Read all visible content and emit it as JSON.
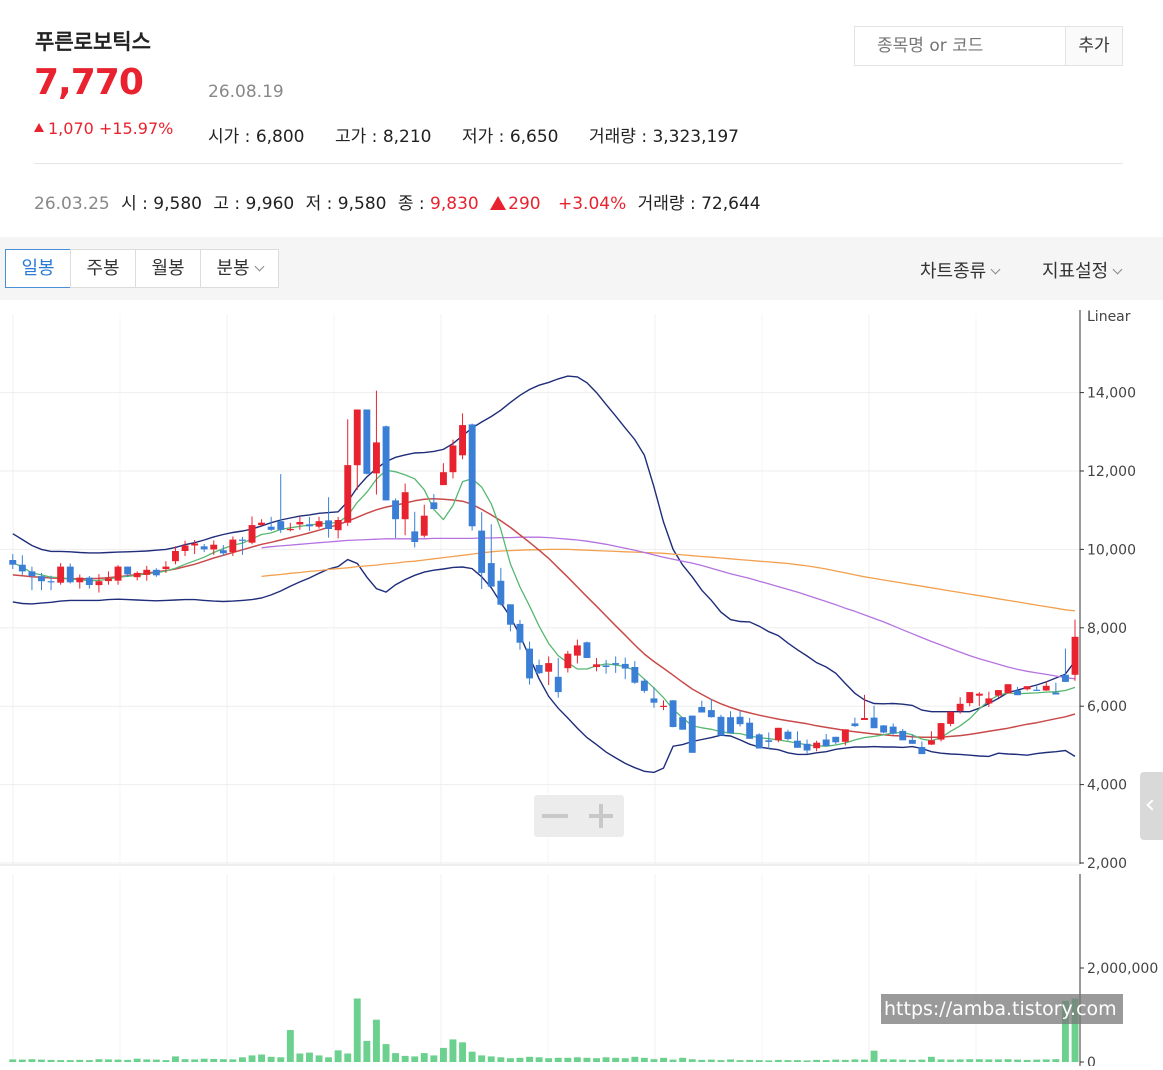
{
  "header": {
    "stock_name": "푸른로보틱스",
    "price": "7,770",
    "date": "26.08.19",
    "change": "1,070",
    "change_pct": "+15.97%",
    "open_label": "시가 : 6,800",
    "high_label": "고가 : 8,210",
    "low_label": "저가 : 6,650",
    "volume_label": "거래량 : 3,323,197"
  },
  "search": {
    "placeholder": "종목명 or 코드",
    "add_label": "추가"
  },
  "hover": {
    "date": "26.03.25",
    "open": "시 : 9,580",
    "high": "고 : 9,960",
    "low": "저 : 9,580",
    "close_label": "종 : ",
    "close_value": "9,830",
    "change": "290",
    "change_pct": "+3.04%",
    "volume": "거래량 : 72,644"
  },
  "toolbar": {
    "tabs": [
      "일봉",
      "주봉",
      "월봉",
      "분봉"
    ],
    "chart_type": "차트종류",
    "indicator": "지표설정"
  },
  "colors": {
    "up": "#e8232f",
    "down": "#3a7fd5",
    "ma5": "#56b870",
    "ma20": "#c94a4a",
    "ma60": "#b573e0",
    "ma120": "#f2a04f",
    "bollinger": "#1f2d7a",
    "volume": "#6cd18e"
  },
  "watermark": "https://amba.tistory.com",
  "chart_data": {
    "type": "candlestick",
    "scale": "Linear",
    "ylim": [
      2000,
      15000
    ],
    "price_ticks": [
      "2,000",
      "4,000",
      "6,000",
      "8,000",
      "10,000",
      "12,000",
      "14,000"
    ],
    "volume_ticks": [
      "0",
      "2,000,000"
    ],
    "volume_max": 3800000,
    "candles": [
      [
        9730,
        9880,
        9500,
        9610
      ],
      [
        9610,
        9850,
        9350,
        9440
      ],
      [
        9440,
        9560,
        8960,
        9320
      ],
      [
        9320,
        9400,
        8960,
        9190
      ],
      [
        9190,
        9330,
        8960,
        9170
      ],
      [
        9150,
        9650,
        9100,
        9560
      ],
      [
        9560,
        9640,
        9130,
        9160
      ],
      [
        9160,
        9360,
        9000,
        9280
      ],
      [
        9280,
        9320,
        9000,
        9090
      ],
      [
        9090,
        9370,
        8900,
        9190
      ],
      [
        9190,
        9440,
        9100,
        9260
      ],
      [
        9200,
        9600,
        9100,
        9560
      ],
      [
        9560,
        9560,
        9300,
        9360
      ],
      [
        9290,
        9440,
        9210,
        9400
      ],
      [
        9350,
        9580,
        9200,
        9480
      ],
      [
        9480,
        9520,
        9300,
        9340
      ],
      [
        9500,
        9700,
        9400,
        9560
      ],
      [
        9700,
        10080,
        9620,
        9960
      ],
      [
        9960,
        10220,
        9830,
        10100
      ],
      [
        10100,
        10240,
        9880,
        10150
      ],
      [
        10080,
        10140,
        9930,
        10000
      ],
      [
        10000,
        10230,
        9860,
        10120
      ],
      [
        9980,
        10110,
        9830,
        9900
      ],
      [
        9930,
        10330,
        9830,
        10250
      ],
      [
        10250,
        10320,
        9860,
        10230
      ],
      [
        10170,
        10840,
        10130,
        10620
      ],
      [
        10620,
        10770,
        10600,
        10680
      ],
      [
        10580,
        10830,
        10470,
        10500
      ],
      [
        10720,
        11920,
        10420,
        10500
      ],
      [
        10500,
        10680,
        10460,
        10520
      ],
      [
        10640,
        10830,
        10500,
        10700
      ],
      [
        10640,
        10830,
        10470,
        10590
      ],
      [
        10580,
        10830,
        10530,
        10720
      ],
      [
        10740,
        11330,
        10300,
        10520
      ],
      [
        10490,
        10830,
        10280,
        10750
      ],
      [
        10680,
        13320,
        10600,
        12150
      ],
      [
        12150,
        13570,
        11520,
        13570
      ],
      [
        13570,
        13340,
        11910,
        11930
      ],
      [
        11940,
        14050,
        11400,
        12730
      ],
      [
        13140,
        13160,
        11680,
        11250
      ],
      [
        11250,
        11300,
        10290,
        10770
      ],
      [
        10770,
        11680,
        10360,
        11460
      ],
      [
        10460,
        10960,
        10050,
        10190
      ],
      [
        10350,
        11140,
        10300,
        10860
      ],
      [
        11200,
        11410,
        11130,
        11030
      ],
      [
        11640,
        12200,
        11780,
        11970
      ],
      [
        11970,
        12800,
        11810,
        12650
      ],
      [
        12400,
        13470,
        12300,
        13170
      ],
      [
        13190,
        13210,
        10480,
        10590
      ],
      [
        10480,
        10950,
        8990,
        9400
      ],
      [
        9650,
        10640,
        9390,
        9050
      ],
      [
        9200,
        9530,
        8570,
        8590
      ],
      [
        8600,
        8450,
        7910,
        8080
      ],
      [
        8100,
        8200,
        7440,
        7620
      ],
      [
        7470,
        7650,
        6550,
        6710
      ],
      [
        7050,
        7190,
        6820,
        6840
      ],
      [
        6880,
        7270,
        6540,
        7100
      ],
      [
        6750,
        7230,
        6220,
        6360
      ],
      [
        6970,
        7410,
        6860,
        7340
      ],
      [
        7290,
        7700,
        7090,
        7550
      ],
      [
        7630,
        7650,
        7350,
        7230
      ],
      [
        7000,
        7230,
        6890,
        7070
      ],
      [
        7040,
        7180,
        6830,
        7000
      ],
      [
        7100,
        7270,
        6850,
        7060
      ],
      [
        7080,
        7240,
        6690,
        6960
      ],
      [
        7000,
        7150,
        6570,
        6600
      ],
      [
        6650,
        6700,
        6340,
        6390
      ],
      [
        6200,
        6480,
        5960,
        6090
      ],
      [
        5990,
        6150,
        5900,
        6010
      ],
      [
        6150,
        5960,
        5460,
        5470
      ],
      [
        5720,
        5430,
        5480,
        5400
      ],
      [
        5760,
        5510,
        4980,
        4810
      ],
      [
        5980,
        6140,
        5850,
        5840
      ],
      [
        5900,
        6180,
        5710,
        5720
      ],
      [
        5730,
        5780,
        5510,
        5250
      ],
      [
        5720,
        5870,
        5480,
        5310
      ],
      [
        5730,
        5900,
        5480,
        5540
      ],
      [
        5580,
        5700,
        5330,
        5170
      ],
      [
        5280,
        5310,
        5030,
        4920
      ],
      [
        5130,
        5330,
        4900,
        5090
      ],
      [
        5130,
        5310,
        5080,
        5450
      ],
      [
        5350,
        5400,
        5120,
        5160
      ],
      [
        5120,
        5360,
        4950,
        4940
      ],
      [
        5040,
        5150,
        4780,
        4870
      ],
      [
        4930,
        5120,
        4850,
        5070
      ],
      [
        5150,
        5290,
        4980,
        4980
      ],
      [
        5220,
        5200,
        5030,
        5080
      ],
      [
        5090,
        5290,
        5000,
        5410
      ],
      [
        5560,
        5710,
        5470,
        5490
      ],
      [
        5650,
        6290,
        5650,
        5700
      ],
      [
        5710,
        6010,
        5470,
        5440
      ],
      [
        5510,
        5520,
        5310,
        5330
      ],
      [
        5480,
        5560,
        5270,
        5300
      ],
      [
        5370,
        5420,
        5150,
        5130
      ],
      [
        5140,
        5280,
        5100,
        5040
      ],
      [
        4960,
        5100,
        4890,
        4780
      ],
      [
        5020,
        5360,
        5010,
        5130
      ],
      [
        5150,
        5390,
        5100,
        5570
      ],
      [
        5550,
        5830,
        5490,
        5860
      ],
      [
        5880,
        6230,
        5810,
        6060
      ],
      [
        6080,
        6360,
        6000,
        6360
      ],
      [
        6270,
        6360,
        6000,
        6320
      ],
      [
        6070,
        6370,
        5980,
        6200
      ],
      [
        6270,
        6390,
        6220,
        6410
      ],
      [
        6330,
        6500,
        6320,
        6560
      ],
      [
        6400,
        6490,
        6330,
        6280
      ],
      [
        6430,
        6500,
        6400,
        6510
      ],
      [
        6420,
        6510,
        6400,
        6390
      ],
      [
        6400,
        6640,
        6390,
        6520
      ],
      [
        6350,
        6600,
        6390,
        6300
      ],
      [
        6800,
        7470,
        6710,
        6620
      ],
      [
        6800,
        8210,
        6650,
        7770
      ]
    ],
    "ma5": [
      9660,
      9550,
      9400,
      9350,
      9290,
      9280,
      9240,
      9230,
      9200,
      9210,
      9240,
      9290,
      9310,
      9340,
      9380,
      9400,
      9450,
      9520,
      9620,
      9710,
      9800,
      9920,
      10020,
      10110,
      10160,
      10270,
      10380,
      10420,
      10510,
      10550,
      10590,
      10620,
      10650,
      10670,
      10680,
      10860,
      11200,
      11460,
      11790,
      12020,
      11980,
      11900,
      11800,
      11520,
      11020,
      10760,
      11120,
      11730,
      11800,
      11590,
      11160,
      10510,
      9630,
      9040,
      8560,
      8040,
      7600,
      7290,
      7110,
      6950,
      6950,
      7030,
      7080,
      7050,
      7010,
      6910,
      6690,
      6470,
      6220,
      5920,
      5700,
      5500,
      5450,
      5410,
      5350,
      5310,
      5300,
      5240,
      5200,
      5170,
      5140,
      5100,
      5060,
      5010,
      4990,
      4980,
      5010,
      5060,
      5140,
      5200,
      5230,
      5270,
      5320,
      5330,
      5270,
      5160,
      5120,
      5200,
      5360,
      5500,
      5680,
      5930,
      6140,
      6280,
      6340,
      6320,
      6330,
      6340,
      6360,
      6370,
      6400,
      6480
    ],
    "ma20": [
      9350,
      9330,
      9300,
      9290,
      9270,
      9260,
      9250,
      9250,
      9250,
      9260,
      9280,
      9300,
      9330,
      9360,
      9390,
      9430,
      9460,
      9500,
      9560,
      9620,
      9700,
      9780,
      9850,
      9920,
      9990,
      10060,
      10130,
      10180,
      10240,
      10300,
      10360,
      10420,
      10490,
      10560,
      10630,
      10720,
      10820,
      10920,
      11010,
      11080,
      11130,
      11180,
      11240,
      11280,
      11290,
      11280,
      11260,
      11230,
      11150,
      11020,
      10880,
      10730,
      10560,
      10370,
      10180,
      9980,
      9770,
      9530,
      9290,
      9040,
      8790,
      8550,
      8300,
      8050,
      7810,
      7560,
      7330,
      7140,
      6970,
      6790,
      6610,
      6440,
      6300,
      6170,
      6060,
      5970,
      5890,
      5830,
      5770,
      5720,
      5670,
      5630,
      5590,
      5550,
      5500,
      5460,
      5420,
      5380,
      5350,
      5320,
      5290,
      5270,
      5250,
      5240,
      5220,
      5210,
      5210,
      5210,
      5230,
      5250,
      5280,
      5320,
      5360,
      5400,
      5440,
      5490,
      5540,
      5580,
      5630,
      5680,
      5730,
      5800
    ],
    "ma60": [
      10040,
      10070,
      10090,
      10110,
      10130,
      10150,
      10170,
      10190,
      10210,
      10230,
      10240,
      10250,
      10260,
      10270,
      10270,
      10270,
      10270,
      10270,
      10280,
      10280,
      10280,
      10280,
      10280,
      10290,
      10290,
      10300,
      10300,
      10310,
      10310,
      10310,
      10300,
      10280,
      10260,
      10240,
      10210,
      10170,
      10130,
      10080,
      10030,
      9980,
      9920,
      9860,
      9800,
      9750,
      9700,
      9650,
      9590,
      9520,
      9450,
      9380,
      9320,
      9260,
      9190,
      9120,
      9050,
      8980,
      8910,
      8830,
      8750,
      8670,
      8590,
      8500,
      8420,
      8330,
      8240,
      8150,
      8050,
      7950,
      7850,
      7750,
      7650,
      7560,
      7470,
      7380,
      7290,
      7210,
      7140,
      7070,
      7000,
      6940,
      6890,
      6850,
      6810,
      6770,
      6730,
      6700
    ],
    "ma120": [
      9310,
      9340,
      9360,
      9390,
      9410,
      9440,
      9460,
      9490,
      9510,
      9530,
      9560,
      9580,
      9600,
      9630,
      9650,
      9680,
      9700,
      9730,
      9760,
      9790,
      9820,
      9850,
      9880,
      9910,
      9940,
      9960,
      9970,
      9980,
      9990,
      9990,
      10000,
      10000,
      10000,
      9990,
      9980,
      9970,
      9960,
      9950,
      9940,
      9930,
      9920,
      9910,
      9900,
      9880,
      9860,
      9840,
      9820,
      9800,
      9780,
      9760,
      9740,
      9720,
      9700,
      9680,
      9660,
      9640,
      9610,
      9580,
      9540,
      9500,
      9450,
      9400,
      9350,
      9300,
      9260,
      9220,
      9180,
      9140,
      9100,
      9060,
      9020,
      8980,
      8940,
      8900,
      8860,
      8820,
      8780,
      8740,
      8700,
      8660,
      8620,
      8580,
      8540,
      8500,
      8460,
      8430
    ],
    "bb_upper": [
      10400,
      10250,
      10100,
      10000,
      9950,
      9950,
      9940,
      9920,
      9910,
      9910,
      9920,
      9930,
      9940,
      9950,
      9960,
      9980,
      10000,
      10050,
      10120,
      10170,
      10240,
      10320,
      10380,
      10430,
      10470,
      10520,
      10600,
      10680,
      10750,
      10800,
      10850,
      10880,
      10920,
      10940,
      10960,
      11220,
      11580,
      11850,
      12060,
      12240,
      12350,
      12410,
      12460,
      12470,
      12500,
      12550,
      12700,
      12900,
      13100,
      13250,
      13390,
      13550,
      13750,
      13930,
      14080,
      14190,
      14260,
      14350,
      14420,
      14400,
      14250,
      14000,
      13700,
      13400,
      13100,
      12800,
      12400,
      11600,
      10700,
      10000,
      9600,
      9300,
      8960,
      8700,
      8400,
      8210,
      8160,
      8150,
      8040,
      7900,
      7800,
      7610,
      7440,
      7280,
      7110,
      7000,
      6840,
      6580,
      6330,
      6160,
      6070,
      6060,
      6070,
      6050,
      6020,
      5900,
      5860,
      5860,
      5860,
      5860,
      5860,
      5950,
      6070,
      6200,
      6350,
      6410,
      6480,
      6540,
      6620,
      6720,
      6820,
      7150
    ],
    "bb_lower": [
      8660,
      8620,
      8610,
      8630,
      8650,
      8680,
      8700,
      8700,
      8700,
      8700,
      8720,
      8730,
      8720,
      8710,
      8700,
      8690,
      8700,
      8710,
      8720,
      8720,
      8700,
      8680,
      8670,
      8680,
      8700,
      8720,
      8760,
      8840,
      8940,
      9060,
      9170,
      9270,
      9390,
      9500,
      9560,
      9740,
      9640,
      9290,
      9000,
      8910,
      9100,
      9230,
      9340,
      9420,
      9470,
      9500,
      9540,
      9550,
      9510,
      9300,
      9020,
      8640,
      8280,
      7800,
      7260,
      6700,
      6250,
      5950,
      5700,
      5440,
      5200,
      5020,
      4830,
      4680,
      4540,
      4430,
      4340,
      4310,
      4420,
      4980,
      5020,
      5100,
      5150,
      5200,
      5260,
      5240,
      5140,
      5030,
      4960,
      4920,
      4890,
      4810,
      4770,
      4770,
      4810,
      4840,
      4900,
      4930,
      4960,
      4960,
      4970,
      4960,
      4960,
      4950,
      4970,
      4920,
      4840,
      4800,
      4780,
      4770,
      4750,
      4730,
      4720,
      4800,
      4780,
      4770,
      4750,
      4790,
      4820,
      4840,
      4870,
      4720
    ],
    "volumes": [
      55,
      50,
      60,
      50,
      45,
      40,
      40,
      45,
      40,
      60,
      55,
      50,
      45,
      70,
      55,
      50,
      40,
      120,
      60,
      55,
      70,
      65,
      60,
      55,
      100,
      140,
      160,
      110,
      100,
      680,
      180,
      200,
      140,
      100,
      250,
      180,
      1350,
      450,
      900,
      380,
      190,
      130,
      120,
      190,
      140,
      300,
      480,
      420,
      220,
      140,
      120,
      100,
      80,
      90,
      110,
      100,
      80,
      90,
      90,
      100,
      90,
      80,
      100,
      90,
      80,
      110,
      90,
      60,
      90,
      50,
      90,
      60,
      45,
      50,
      40,
      55,
      40,
      45,
      40,
      35,
      45,
      40,
      40,
      35,
      45,
      40,
      50,
      45,
      55,
      50,
      240,
      60,
      55,
      50,
      45,
      50,
      110,
      55,
      50,
      55,
      60,
      60,
      55,
      55,
      60,
      50,
      45,
      50,
      55,
      60,
      1300,
      1350
    ]
  }
}
